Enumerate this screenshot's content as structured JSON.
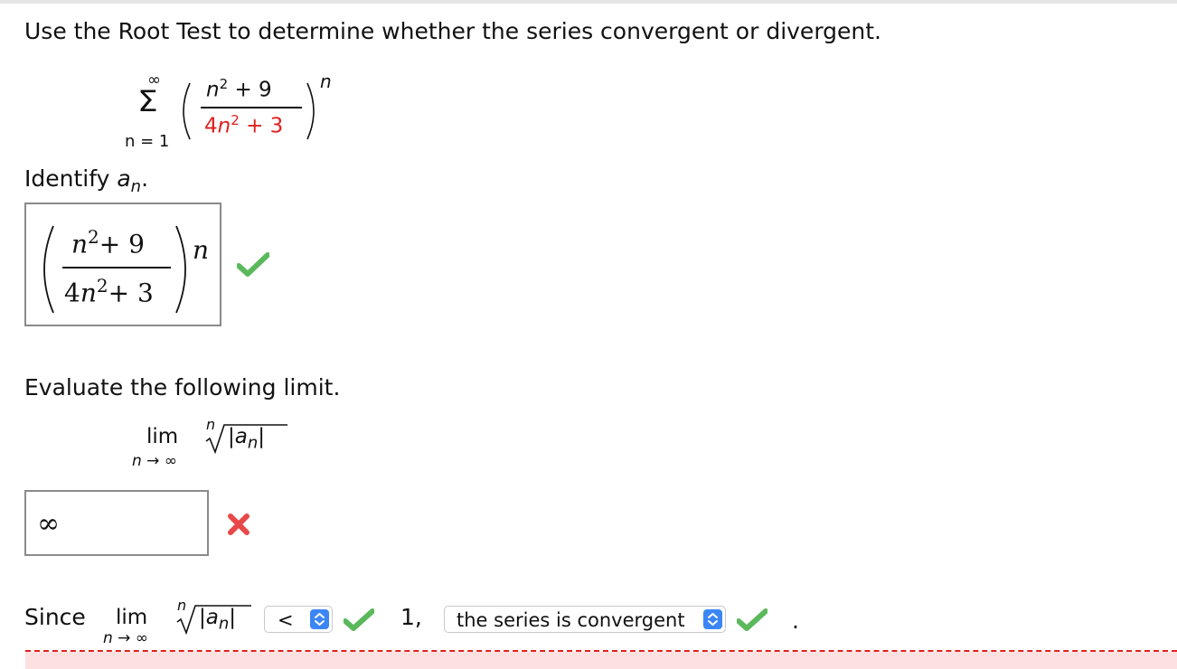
{
  "question": {
    "title": "Use the Root Test to determine whether the series convergent or divergent."
  },
  "series": {
    "sum_upper": "∞",
    "sum_lower": "n = 1",
    "sum_symbol": "Σ",
    "num_var": "n",
    "num_exp": "2",
    "num_rest": "+ 9",
    "den_coef": "4",
    "den_var": "n",
    "den_exp": "2",
    "den_rest": "+ 3",
    "power": "n"
  },
  "identify": {
    "label": "Identify",
    "var": "a",
    "sub": "n",
    "period": ".",
    "answer": {
      "num_var": "n",
      "num_exp": "2",
      "num_rest": "+ 9",
      "den_coef": "4",
      "den_var": "n",
      "den_exp": "2",
      "den_rest": "+ 3",
      "power": "n"
    },
    "status_icon": "checkmark-icon"
  },
  "evaluate": {
    "label": "Evaluate the following limit.",
    "lim": "lim",
    "lim_sub": "n → ∞",
    "root_index": "n",
    "abs_left": "|",
    "a": "a",
    "a_sub": "n",
    "abs_right": "|",
    "answer_value": "∞",
    "status_icon": "x-mark-icon"
  },
  "since": {
    "label": "Since",
    "lim": "lim",
    "lim_sub": "n → ∞",
    "root_index": "n",
    "abs_left": "|",
    "a": "a",
    "a_sub": "n",
    "abs_right": "|",
    "comparison_select": "<",
    "value": "1,",
    "conclusion_select": "the series is convergent",
    "end": "."
  },
  "colors": {
    "accent_red": "#e0201f",
    "check_green": "#5cb85c",
    "select_blue": "#3b86f6"
  }
}
